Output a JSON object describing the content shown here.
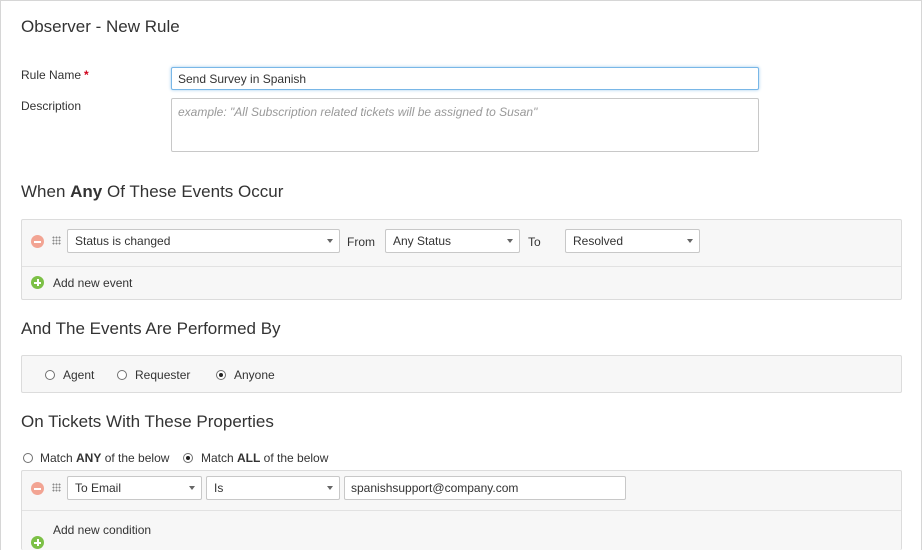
{
  "page": {
    "title": "Observer - New Rule"
  },
  "rule_form": {
    "name_label": "Rule Name",
    "required_mark": "*",
    "name_value": "Send Survey in Spanish",
    "description_label": "Description",
    "description_placeholder": "example: \"All Subscription related tickets will be assigned to Susan\""
  },
  "events_section": {
    "title_prefix": "When ",
    "title_bold": "Any",
    "title_suffix": " Of These Events Occur",
    "event_row": {
      "event_select": "Status is changed",
      "from_label": "From",
      "from_select": "Any Status",
      "to_label": "To",
      "to_select": "Resolved"
    },
    "add_label": "Add new event"
  },
  "performed_section": {
    "title": "And The Events Are Performed By",
    "options": [
      {
        "label": "Agent",
        "checked": false
      },
      {
        "label": "Requester",
        "checked": false
      },
      {
        "label": "Anyone",
        "checked": true
      }
    ]
  },
  "properties_section": {
    "title": "On Tickets With These Properties",
    "match_any": {
      "prefix": "Match ",
      "bold": "ANY",
      "suffix": " of the below",
      "checked": false
    },
    "match_all": {
      "prefix": "Match ",
      "bold": "ALL",
      "suffix": " of the below",
      "checked": true
    },
    "condition_row": {
      "field_select": "To Email",
      "operator_select": "Is",
      "value": "spanishsupport@company.com"
    },
    "add_label": "Add new condition"
  }
}
